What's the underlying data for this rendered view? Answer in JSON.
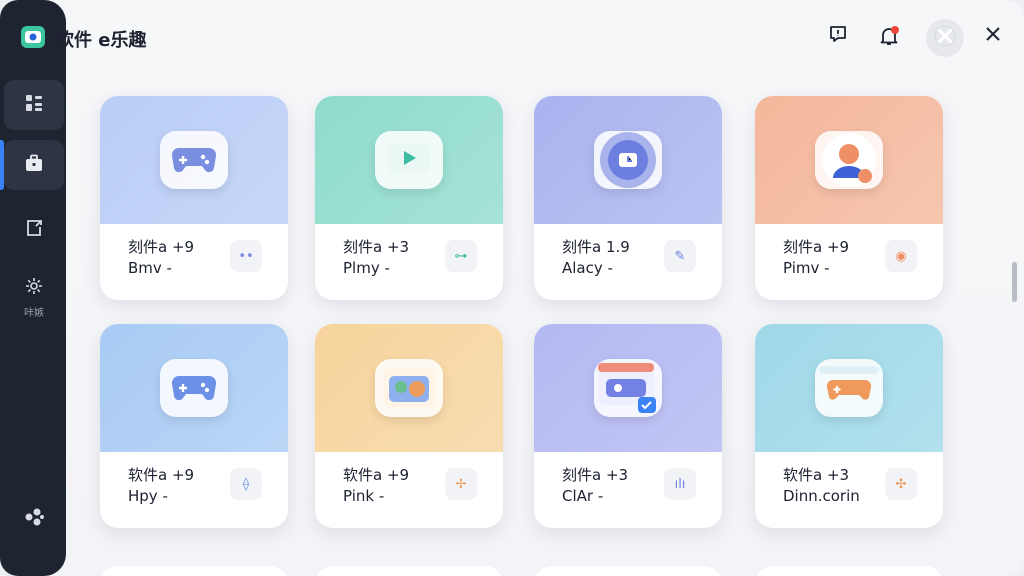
{
  "app": {
    "title": "软件 e乐趣"
  },
  "sidebar": {
    "items": [
      {
        "icon": "dashboard-icon",
        "label": ""
      },
      {
        "icon": "briefcase-icon",
        "label": ""
      },
      {
        "icon": "export-icon",
        "label": ""
      },
      {
        "icon": "gear-icon",
        "label": "咔嫉"
      },
      {
        "icon": "cluster-icon",
        "label": ""
      }
    ]
  },
  "header": {
    "feedback_icon": "feedback-icon",
    "notification_icon": "bell-icon",
    "avatar_icon": "avatar-icon",
    "close_icon": "close-icon"
  },
  "cards": [
    {
      "title": "刻件a +9",
      "sub": "Bmv -",
      "badge": "••",
      "icon": "gamepad-icon",
      "bg": "#b9cdf6",
      "accent": "#7b8fe0"
    },
    {
      "title": "刻件a +3",
      "sub": "Plmy -",
      "badge": "⊶",
      "icon": "video-play-icon",
      "bg": "#8fdccc",
      "accent": "#3fbca4"
    },
    {
      "title": "刻件a 1.9",
      "sub": "Alacy -",
      "badge": "✎",
      "icon": "clock-dial-icon",
      "bg": "#a9b4ef",
      "accent": "#6c7ee0"
    },
    {
      "title": "刻件a +9",
      "sub": "Pimv -",
      "badge": "◉",
      "icon": "user-profile-icon",
      "bg": "#f4b79b",
      "accent": "#ee8f66"
    },
    {
      "title": "软件a +9",
      "sub": "Hpy -",
      "badge": "⟠",
      "icon": "gamepad-icon",
      "bg": "#a9cbf4",
      "accent": "#6b90e6"
    },
    {
      "title": "软件a +9",
      "sub": "Pink -",
      "badge": "✢",
      "icon": "photo-window-icon",
      "bg": "#f7d49c",
      "accent": "#ec9c5c"
    },
    {
      "title": "刻件a +3",
      "sub": "ClAr -",
      "badge": "ılı",
      "icon": "window-check-icon",
      "bg": "#b3b8f2",
      "accent": "#7481e4"
    },
    {
      "title": "软件a +3",
      "sub": "Dinn.corin",
      "badge": "✣",
      "icon": "gamepad-window-icon",
      "bg": "#9fd8e8",
      "accent": "#ef9a5c"
    }
  ]
}
